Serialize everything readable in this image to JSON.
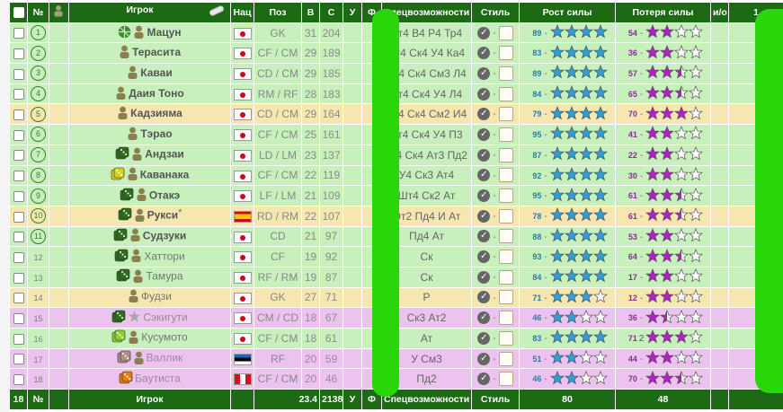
{
  "header": {
    "count_col": "№",
    "player_col": "Игрок",
    "nat_col": "Нац",
    "pos_col": "Поз",
    "age_col": "В",
    "strength_col": "С",
    "u_col": "У",
    "f_col": "Ф",
    "skills_col": "Спецвозможности",
    "style_col": "Стиль",
    "growth_col": "Рост силы",
    "loss_col": "Потеря силы",
    "io_col": "и/о",
    "extra_col": "1"
  },
  "footer": {
    "count": "18",
    "num_col": "№",
    "player_col": "Игрок",
    "avg_age": "23.4",
    "total_strength": "2138",
    "u_col": "У",
    "f_col": "Ф",
    "skills_col": "Спецвозможности",
    "style_col": "Стиль",
    "growth_total": "80",
    "loss_total": "48"
  },
  "colors": {
    "header_bg": "#1c6a14",
    "row_green": "#c7f0bd",
    "row_yellow": "#f6e6b0",
    "row_pink": "#ebc3ee",
    "growth_star": "#2f9fd8",
    "loss_star": "#b31ec7",
    "overlay_green": "#29d60a"
  },
  "players": [
    {
      "num": "1",
      "circled": true,
      "icons": [
        "ball-icon",
        "person-icon"
      ],
      "name": "Мацун",
      "bold": true,
      "flag": "jp",
      "pos": "GK",
      "age": "31",
      "str": "204",
      "skills": "Ат4 В4 Р4 Тр4",
      "growth": "89",
      "growth_stars": 4,
      "loss": "54",
      "loss_stars": 2,
      "row": "green"
    },
    {
      "num": "2",
      "circled": true,
      "icons": [
        "person-icon"
      ],
      "name": "Терасита",
      "bold": true,
      "flag": "jp",
      "pos": "CF / CM",
      "age": "29",
      "str": "189",
      "skills": "Ат4 Ск4 У4 Ка4",
      "growth": "83",
      "growth_stars": 4,
      "loss": "36",
      "loss_stars": 2,
      "row": "green"
    },
    {
      "num": "3",
      "circled": true,
      "icons": [
        "person-icon"
      ],
      "name": "Каваи",
      "bold": true,
      "flag": "jp",
      "pos": "CD / CM",
      "age": "29",
      "str": "185",
      "skills": "Ат4 Ск4 См3 Л4",
      "growth": "89",
      "growth_stars": 4,
      "loss": "57",
      "loss_stars": 2.5,
      "row": "green"
    },
    {
      "num": "4",
      "circled": true,
      "icons": [
        "person-icon"
      ],
      "name": "Даия Тоно",
      "bold": true,
      "flag": "jp",
      "pos": "RM / RF",
      "age": "28",
      "str": "183",
      "skills": "Ат4 Ск4 У4 Л4",
      "growth": "84",
      "growth_stars": 4,
      "loss": "65",
      "loss_stars": 2.5,
      "row": "green"
    },
    {
      "num": "5",
      "circled": true,
      "icons": [
        "person-icon"
      ],
      "name": "Кадзияма",
      "bold": true,
      "flag": "jp",
      "pos": "CD / CM",
      "age": "29",
      "str": "164",
      "skills": "Ат4 Ск4 См2 И4",
      "growth": "79",
      "growth_stars": 4,
      "loss": "70",
      "loss_stars": 3,
      "row": "yellow"
    },
    {
      "num": "6",
      "circled": true,
      "icons": [
        "person-icon"
      ],
      "name": "Тэрао",
      "bold": true,
      "flag": "jp",
      "pos": "CF / CM",
      "age": "25",
      "str": "161",
      "skills": "Ат4 Ск4 У4 П3",
      "growth": "95",
      "growth_stars": 4,
      "loss": "41",
      "loss_stars": 2,
      "row": "green"
    },
    {
      "num": "7",
      "circled": true,
      "icons": [
        "die-icon",
        "person-icon"
      ],
      "name": "Андзаи",
      "bold": true,
      "flag": "jp",
      "pos": "LD / LM",
      "age": "23",
      "str": "137",
      "skills": "Уг4 Ск4 Ат3 Пд2",
      "growth": "87",
      "growth_stars": 4,
      "loss": "22",
      "loss_stars": 2,
      "row": "green"
    },
    {
      "num": "8",
      "circled": true,
      "icons": [
        "die-yellow-icon",
        "person-icon"
      ],
      "name": "Кaванака",
      "bold": true,
      "flag": "jp",
      "pos": "CF / CM",
      "age": "22",
      "str": "119",
      "skills": "У4 Ск3 Ат4",
      "growth": "92",
      "growth_stars": 4,
      "loss": "30",
      "loss_stars": 2,
      "row": "green"
    },
    {
      "num": "9",
      "circled": true,
      "icons": [
        "die-icon",
        "person-icon"
      ],
      "name": "Отакэ",
      "bold": true,
      "flag": "jp",
      "pos": "LF / LM",
      "age": "21",
      "str": "109",
      "skills": "Шт4 Ск2 Ат",
      "growth": "95",
      "growth_stars": 4,
      "loss": "61",
      "loss_stars": 2.5,
      "row": "green"
    },
    {
      "num": "10",
      "circled": true,
      "icons": [
        "die-icon",
        "person-icon"
      ],
      "name": "Рукси",
      "bold": true,
      "flag": "es",
      "pos": "RD / RM",
      "age": "22",
      "str": "107",
      "skills": "От2 Пд4 И Ат",
      "growth": "78",
      "growth_stars": 4,
      "loss": "61",
      "loss_stars": 2.5,
      "row": "yellow",
      "mark": "*"
    },
    {
      "num": "11",
      "circled": true,
      "icons": [
        "die-icon",
        "person-icon"
      ],
      "name": "Судзуки",
      "bold": true,
      "flag": "jp",
      "pos": "CD",
      "age": "21",
      "str": "97",
      "skills": "Пд4 Ат",
      "growth": "88",
      "growth_stars": 4,
      "loss": "53",
      "loss_stars": 2,
      "row": "green"
    },
    {
      "num": "12",
      "circled": false,
      "icons": [
        "die-icon",
        "person-icon"
      ],
      "name": "Хаттори",
      "bold": false,
      "flag": "jp",
      "pos": "CF",
      "age": "19",
      "str": "92",
      "skills": "Ск",
      "growth": "93",
      "growth_stars": 4,
      "loss": "64",
      "loss_stars": 2.5,
      "row": "green"
    },
    {
      "num": "13",
      "circled": false,
      "icons": [
        "die-icon",
        "person-icon"
      ],
      "name": "Тамура",
      "bold": false,
      "flag": "jp",
      "pos": "RF / RM",
      "age": "19",
      "str": "87",
      "skills": "Ск",
      "growth": "84",
      "growth_stars": 4,
      "loss": "17",
      "loss_stars": 2,
      "row": "green"
    },
    {
      "num": "14",
      "circled": false,
      "icons": [
        "person-icon"
      ],
      "name": "Фудзи",
      "bold": false,
      "flag": "jp",
      "pos": "GK",
      "age": "27",
      "str": "71",
      "skills": "Р",
      "growth": "71",
      "growth_stars": 3,
      "loss": "12",
      "loss_stars": 2,
      "row": "yellow"
    },
    {
      "num": "15",
      "circled": false,
      "icons": [
        "die-icon",
        "star-icon"
      ],
      "name": "Сэкигути",
      "bold": false,
      "flag": "jp",
      "pos": "CM / CD",
      "age": "18",
      "str": "67",
      "skills": "Ск3 Ат2",
      "growth": "46",
      "growth_stars": 2,
      "loss": "36",
      "loss_stars": 1.5,
      "row": "pink"
    },
    {
      "num": "16",
      "circled": false,
      "icons": [
        "die-lime-icon",
        "person-icon"
      ],
      "name": "Кусумото",
      "bold": false,
      "flag": "jp",
      "pos": "CF / CM",
      "age": "18",
      "str": "61",
      "skills": "Ат",
      "growth": "83",
      "growth_stars": 4,
      "loss": "71",
      "loss_stars": 3,
      "row": "green",
      "loss_extra": "2"
    },
    {
      "num": "17",
      "circled": false,
      "icons": [
        "die-pink-icon",
        "person-icon"
      ],
      "name": "Валлик",
      "bold": false,
      "flag": "ee",
      "pos": "RF",
      "age": "20",
      "str": "59",
      "skills": "У См3",
      "growth": "51",
      "growth_stars": 2,
      "loss": "44",
      "loss_stars": 2,
      "row": "pink"
    },
    {
      "num": "18",
      "circled": false,
      "icons": [
        "die-orange-icon"
      ],
      "name": "Баутиста",
      "bold": false,
      "flag": "pe",
      "pos": "CF / CM",
      "age": "20",
      "str": "46",
      "skills": "Пд2",
      "growth": "46",
      "growth_stars": 2,
      "loss": "70",
      "loss_stars": 2.5,
      "row": "pink"
    }
  ]
}
